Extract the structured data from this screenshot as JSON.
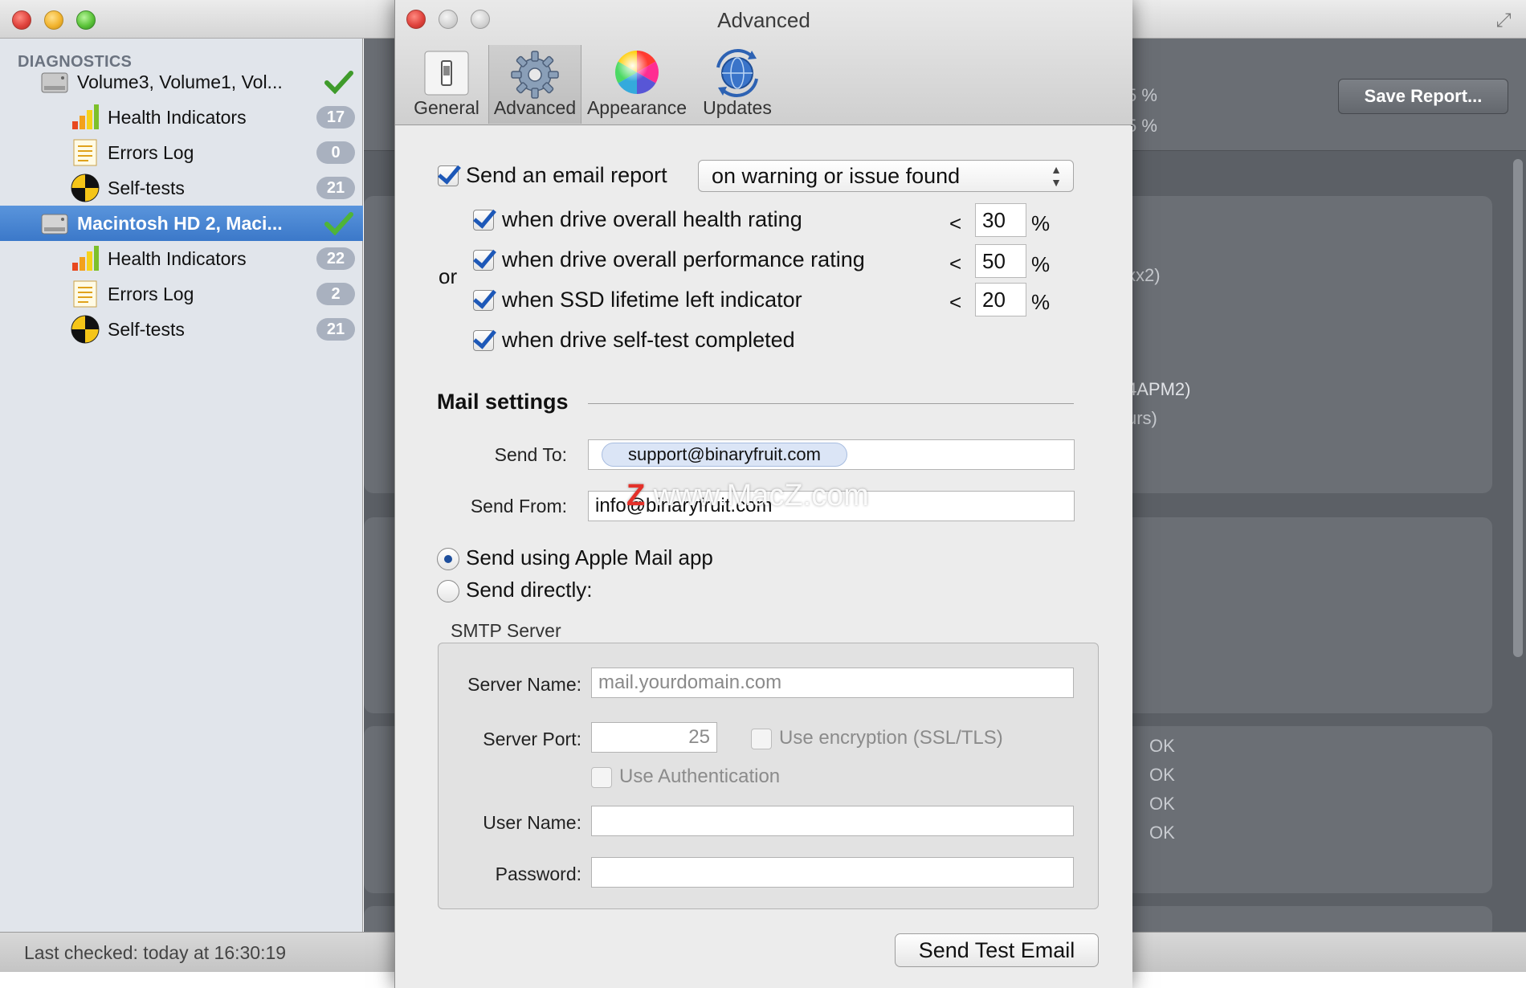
{
  "main_window": {
    "sidebar": {
      "header": "DIAGNOSTICS",
      "items": [
        {
          "label": "Volume3, Volume1, Vol...",
          "type": "drive",
          "status": "ok"
        },
        {
          "label": "Health Indicators",
          "type": "health",
          "badge": "17"
        },
        {
          "label": "Errors Log",
          "type": "log",
          "badge": "0"
        },
        {
          "label": "Self-tests",
          "type": "selftest",
          "badge": "21"
        },
        {
          "label": "Macintosh HD 2, Maci...",
          "type": "drive",
          "status": "ok",
          "selected": true
        },
        {
          "label": "Health Indicators",
          "type": "health",
          "badge": "22"
        },
        {
          "label": "Errors Log",
          "type": "log",
          "badge": "2"
        },
        {
          "label": "Self-tests",
          "type": "selftest",
          "badge": "21"
        }
      ]
    },
    "status": "Last checked: today at 16:30:19",
    "save_report_label": "Save Report...",
    "partial_text": {
      "pct1": "5 %",
      "pct2": "5 %",
      "x2": "xx2)",
      "apm2": "4APM2)",
      "hours": "urs)",
      "ok": [
        "OK",
        "OK",
        "OK",
        "OK"
      ]
    }
  },
  "dialog": {
    "title": "Advanced",
    "tabs": [
      {
        "label": "General",
        "icon": "switch-icon"
      },
      {
        "label": "Advanced",
        "icon": "gear-icon",
        "active": true
      },
      {
        "label": "Appearance",
        "icon": "color-wheel-icon"
      },
      {
        "label": "Updates",
        "icon": "globe-update-icon"
      }
    ],
    "email_report": {
      "label": "Send an email report",
      "checked": true,
      "trigger": "on warning or issue found",
      "or_label": "or",
      "conditions": [
        {
          "label": "when drive overall health rating",
          "checked": true,
          "op": "<",
          "value": "30",
          "unit": "%"
        },
        {
          "label": "when drive overall performance rating",
          "checked": true,
          "op": "<",
          "value": "50",
          "unit": "%"
        },
        {
          "label": "when SSD lifetime left indicator",
          "checked": true,
          "op": "<",
          "value": "20",
          "unit": "%"
        },
        {
          "label": "when drive self-test completed",
          "checked": true
        }
      ]
    },
    "mail": {
      "title": "Mail settings",
      "send_to_label": "Send To:",
      "send_to": "support@binaryfruit.com",
      "send_from_label": "Send From:",
      "send_from": "info@binaryfruit.com",
      "method_apple": "Send using Apple Mail app",
      "method_direct": "Send directly:",
      "selected_method": "apple"
    },
    "smtp": {
      "caption": "SMTP Server",
      "server_name_label": "Server Name:",
      "server_name_placeholder": "mail.yourdomain.com",
      "port_label": "Server Port:",
      "port": "25",
      "encryption_label": "Use encryption (SSL/TLS)",
      "auth_label": "Use Authentication",
      "user_label": "User Name:",
      "password_label": "Password:"
    },
    "test_button": "Send Test Email"
  },
  "watermark": {
    "z": "Z",
    "text": "www.MacZ.com"
  },
  "colors": {
    "selection": "#3b78c9",
    "checkmark": "#1d58b8",
    "ok_green": "#3f9b2b"
  }
}
